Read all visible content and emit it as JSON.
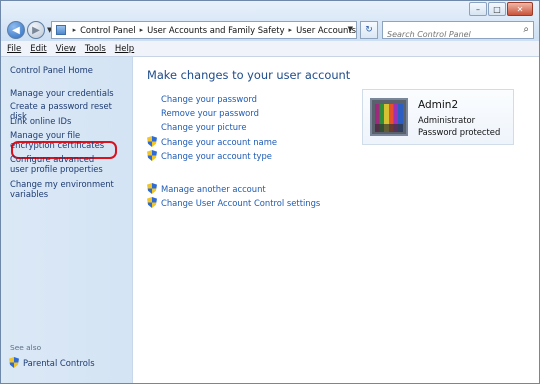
{
  "window": {
    "controls": [
      "–",
      "□",
      "✕"
    ]
  },
  "address": {
    "crumbs": [
      "Control Panel",
      "User Accounts and Family Safety",
      "User Accounts"
    ]
  },
  "search": {
    "placeholder": "Search Control Panel"
  },
  "menu": [
    "File",
    "Edit",
    "View",
    "Tools",
    "Help"
  ],
  "sidebar": {
    "top": "Control Panel Home",
    "links": [
      "Manage your credentials",
      "Create a password reset disk",
      "Link online IDs",
      "Manage your file encryption certificates",
      "Configure advanced user profile properties",
      "Change my environment variables"
    ],
    "see_also_label": "See also",
    "see_also_items": [
      "Parental Controls"
    ]
  },
  "main": {
    "heading": "Make changes to your user account",
    "tasks": [
      "Change your password",
      "Remove your password",
      "Change your picture",
      "Change your account name",
      "Change your account type"
    ],
    "manage": [
      "Manage another account",
      "Change User Account Control settings"
    ]
  },
  "account": {
    "name": "Admin2",
    "role": "Administrator",
    "status": "Password protected"
  }
}
